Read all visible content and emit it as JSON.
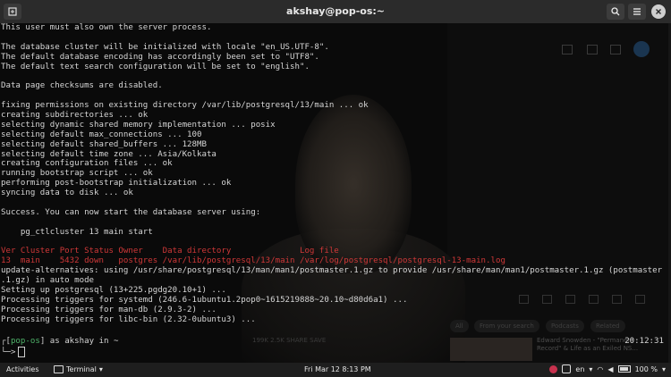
{
  "window": {
    "title": "akshay@pop-os:~"
  },
  "terminal": {
    "lines": [
      "This user must also own the server process.",
      "",
      "The database cluster will be initialized with locale \"en_US.UTF-8\".",
      "The default database encoding has accordingly been set to \"UTF8\".",
      "The default text search configuration will be set to \"english\".",
      "",
      "Data page checksums are disabled.",
      "",
      "fixing permissions on existing directory /var/lib/postgresql/13/main ... ok",
      "creating subdirectories ... ok",
      "selecting dynamic shared memory implementation ... posix",
      "selecting default max_connections ... 100",
      "selecting default shared_buffers ... 128MB",
      "selecting default time zone ... Asia/Kolkata",
      "creating configuration files ... ok",
      "running bootstrap script ... ok",
      "performing post-bootstrap initialization ... ok",
      "syncing data to disk ... ok",
      "",
      "Success. You can now start the database server using:",
      "",
      "    pg_ctlcluster 13 main start",
      "",
      "Ver Cluster Port Status Owner    Data directory              Log file",
      "13  main    5432 down   postgres /var/lib/postgresql/13/main /var/log/postgresql/postgresql-13-main.log",
      "update-alternatives: using /usr/share/postgresql/13/man/man1/postmaster.1.gz to provide /usr/share/man/man1/postmaster.1.gz (postmaster",
      ".1.gz) in auto mode",
      "Setting up postgresql (13+225.pgdg20.10+1) ...",
      "Processing triggers for systemd (246.6-1ubuntu1.2pop0~1615219888~20.10~d80d6a1) ...",
      "Processing triggers for man-db (2.9.3-2) ...",
      "Processing triggers for libc-bin (2.32-0ubuntu3) ..."
    ],
    "prompt": {
      "open": "┌[",
      "host": "pop-os",
      "close": "]",
      "text": " as akshay in ~",
      "second": "└─>",
      "time": "20:12:31"
    }
  },
  "overlay": {
    "chips": [
      "All",
      "From your search",
      "Podcasts",
      "Related"
    ],
    "actions": "199K     2.5K     SHARE     SAVE",
    "video_title": "Edward Snowden - \"Permanent Record\" & Life as an Exiled NS..."
  },
  "taskbar": {
    "activities": "Activities",
    "app": "Terminal",
    "clock": "Fri Mar 12   8:13 PM",
    "lang": "en",
    "battery": "100 %"
  }
}
